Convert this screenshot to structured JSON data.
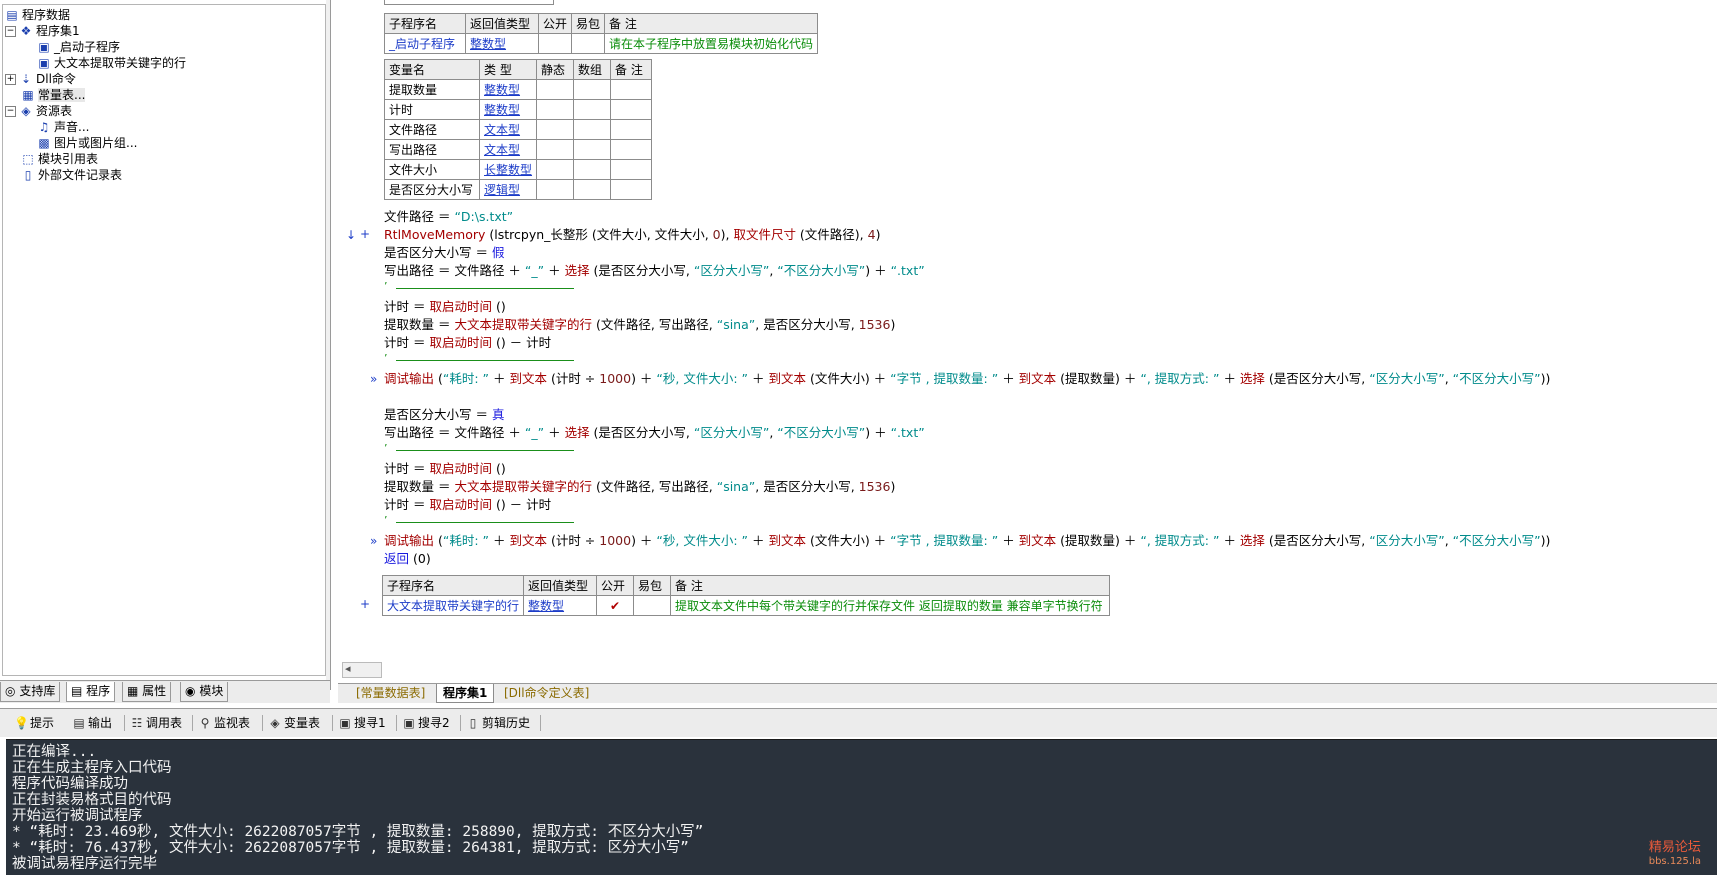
{
  "tree": {
    "root": "程序数据",
    "items": [
      {
        "label": "程序集1",
        "icon": "module-icon",
        "indent": 1,
        "toggle": "-"
      },
      {
        "label": "_启动子程序",
        "icon": "sub-icon",
        "indent": 2,
        "toggle": ""
      },
      {
        "label": "大文本提取带关键字的行",
        "icon": "sub-icon",
        "indent": 2,
        "toggle": ""
      },
      {
        "label": "Dll命令",
        "icon": "dll-icon",
        "indent": 1,
        "toggle": "+"
      },
      {
        "label": "常量表...",
        "icon": "constant-icon",
        "indent": 1,
        "toggle": ""
      },
      {
        "label": "资源表",
        "icon": "resource-icon",
        "indent": 1,
        "toggle": "-"
      },
      {
        "label": "声音...",
        "icon": "sound-icon",
        "indent": 2,
        "toggle": ""
      },
      {
        "label": "图片或图片组...",
        "icon": "image-icon",
        "indent": 2,
        "toggle": ""
      },
      {
        "label": "模块引用表",
        "icon": "module-ref-icon",
        "indent": 1,
        "toggle": ""
      },
      {
        "label": "外部文件记录表",
        "icon": "file-icon",
        "indent": 1,
        "toggle": ""
      }
    ]
  },
  "left_tabs": [
    "支持库",
    "程序",
    "属性",
    "模块"
  ],
  "sub_header": {
    "cols": [
      "子程序名",
      "返回值类型",
      "公开",
      "易包",
      "备 注"
    ],
    "row": {
      "name": "_启动子程序",
      "type": "整数型",
      "public": "",
      "pack": "",
      "note": "请在本子程序中放置易模块初始化代码"
    }
  },
  "var_header": {
    "cols": [
      "变量名",
      "类 型",
      "静态",
      "数组",
      "备 注"
    ],
    "rows": [
      {
        "name": "提取数量",
        "type": "整数型"
      },
      {
        "name": "计时",
        "type": "整数型"
      },
      {
        "name": "文件路径",
        "type": "文本型"
      },
      {
        "name": "写出路径",
        "type": "文本型"
      },
      {
        "name": "文件大小",
        "type": "长整数型"
      },
      {
        "name": "是否区分大小写",
        "type": "逻辑型"
      }
    ]
  },
  "code": {
    "l1_a": "文件路径 ＝ ",
    "l1_b": "“D:\\s.txt”",
    "l2_a": "RtlMoveMemory",
    "l2_b": " (lstrcpyn_长整形 (文件大小, 文件大小, ",
    "l2_c": "0",
    "l2_d": "), ",
    "l2_e": "取文件尺寸",
    "l2_f": " (文件路径), ",
    "l2_g": "4",
    "l2_h": ")",
    "l3_a": "是否区分大小写 ＝ ",
    "l3_b": "假",
    "l4_a": "写出路径 ＝ 文件路径 ＋ ",
    "l4_b": "“_”",
    "l4_c": " ＋ ",
    "l4_d": "选择",
    "l4_e": " (是否区分大小写, ",
    "l4_f": "“区分大小写”",
    "l4_g": ", ",
    "l4_h": "“不区分大小写”",
    "l4_i": ") ＋ ",
    "l4_j": "“.txt”",
    "l5_a": "计时 ＝ ",
    "l5_b": "取启动时间",
    "l5_c": " ()",
    "l6_a": "提取数量 ＝ ",
    "l6_b": "大文本提取带关键字的行",
    "l6_c": " (文件路径, 写出路径, ",
    "l6_d": "“sina”",
    "l6_e": ", 是否区分大小写, ",
    "l6_f": "1536",
    "l6_g": ")",
    "l7_a": "计时 ＝ ",
    "l7_b": "取启动时间",
    "l7_c": " () － 计时",
    "l8_a": "调试输出",
    "l8_b": " (",
    "l8_c": "“耗时: ”",
    "l8_d": " ＋ ",
    "l8_e": "到文本",
    "l8_f": " (计时 ÷ ",
    "l8_g": "1000",
    "l8_h": ") ＋ ",
    "l8_i": "“秒, 文件大小: ”",
    "l8_j": " ＋ ",
    "l8_k": "到文本",
    "l8_l": " (文件大小) ＋ ",
    "l8_m": "“字节 , 提取数量: ”",
    "l8_n": " ＋ ",
    "l8_o": "到文本",
    "l8_p": " (提取数量) ＋ ",
    "l8_q": "“, 提取方式: ”",
    "l8_r": " ＋ ",
    "l8_s": "选择",
    "l8_t": " (是否区分大小写, ",
    "l8_u": "“区分大小写”",
    "l8_v": ", ",
    "l8_w": "“不区分大小写”",
    "l8_x": "))",
    "l9_b": "真",
    "l17_a": "返回",
    "l17_b": " (0)",
    "tick": "’"
  },
  "sub_header2": {
    "cols": [
      "子程序名",
      "返回值类型",
      "公开",
      "易包",
      "备 注"
    ],
    "row": {
      "name": "大文本提取带关键字的行",
      "type": "整数型",
      "public": "✔",
      "pack": "",
      "note": "提取文本文件中每个带关键字的行并保存文件 返回提取的数量 兼容单字节换行符"
    }
  },
  "doc_tabs": [
    "[常量数据表]",
    "程序集1",
    "[Dll命令定义表]"
  ],
  "bottom_tabs": [
    {
      "label": "提示",
      "icon": "hint-icon"
    },
    {
      "label": "输出",
      "icon": "output-icon"
    },
    {
      "label": "调用表",
      "icon": "callstack-icon"
    },
    {
      "label": "监视表",
      "icon": "watch-icon"
    },
    {
      "label": "变量表",
      "icon": "variable-icon"
    },
    {
      "label": "搜寻1",
      "icon": "search1-icon"
    },
    {
      "label": "搜寻2",
      "icon": "search2-icon"
    },
    {
      "label": "剪辑历史",
      "icon": "clip-history-icon"
    }
  ],
  "console": [
    "正在编译...",
    "正在生成主程序入口代码",
    "程序代码编译成功",
    "正在封装易格式目的代码",
    "开始运行被调试程序",
    "* “耗时: 23.469秒, 文件大小: 2622087057字节 , 提取数量: 258890, 提取方式: 不区分大小写”",
    "* “耗时: 76.437秒, 文件大小: 2622087057字节 , 提取数量: 264381, 提取方式: 区分大小写”",
    "被调试易程序运行完毕"
  ],
  "watermark": {
    "title": "精易论坛",
    "sub": "bbs.125.la"
  },
  "colors": {
    "accent": "#1c3cc8",
    "note": "#098c09",
    "string": "#008b8b",
    "call": "#a30000",
    "console_bg": "#2a323c"
  }
}
